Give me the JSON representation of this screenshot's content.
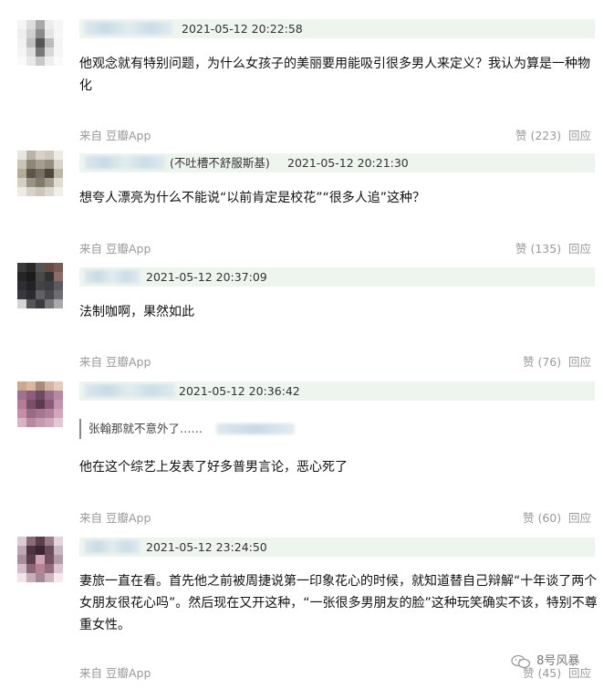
{
  "comments": [
    {
      "time": "2021-05-12 20:22:58",
      "subtitle": "",
      "text": "他观念就有特别问题，为什么女孩子的美丽要用能吸引很多男人来定义？我认为算是一种物化",
      "source": "来自 豆瓣App",
      "likes": "赞 (223)",
      "reply": "回应"
    },
    {
      "time": "2021-05-12 20:21:30",
      "subtitle": "(不吐槽不舒服斯基)",
      "text": "想夸人漂亮为什么不能说“以前肯定是校花”“很多人追”这种？",
      "source": "来自 豆瓣App",
      "likes": "赞 (135)",
      "reply": "回应"
    },
    {
      "time": "2021-05-12 20:37:09",
      "subtitle": "",
      "text": "法制咖啊，果然如此",
      "source": "来自 豆瓣App",
      "likes": "赞 (76)",
      "reply": "回应"
    },
    {
      "time": "2021-05-12 20:36:42",
      "subtitle": "",
      "quote": "张翰那就不意外了……",
      "text": "他在这个综艺上发表了好多普男言论，恶心死了",
      "source": "来自 豆瓣App",
      "likes": "赞 (60)",
      "reply": "回应"
    },
    {
      "time": "2021-05-12 23:24:50",
      "subtitle": "",
      "text": "妻旅一直在看。首先他之前被周捷说第一印象花心的时候，就知道替自己辩解“十年谈了两个女朋友很花心吗”。然后现在又开这种，“一张很多男朋友的脸”这种玩笑确实不该，特别不尊重女性。",
      "source": "来自 豆瓣App",
      "likes": "赞 (45)",
      "reply": "回应"
    }
  ],
  "watermark": "8号风暴",
  "colors": {
    "meta_bg": "#eef4ee",
    "muted": "#999999"
  }
}
